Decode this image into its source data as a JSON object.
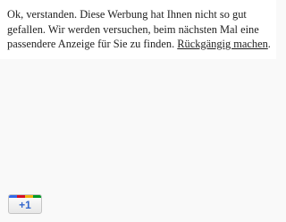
{
  "notice": {
    "text": "Ok, verstanden. Diese Werbung hat Ihnen nicht so gut gefallen. Wir werden versuchen, beim nächsten Mal eine passendere Anzeige für Sie zu finden.",
    "undo_link": "Rückgängig machen",
    "trailing": "."
  },
  "plus_one_button": {
    "label": "+1",
    "icon": "google-plus-one-icon",
    "strip_colors": [
      "#3369e8",
      "#d50f25",
      "#eeb211",
      "#009925"
    ]
  }
}
